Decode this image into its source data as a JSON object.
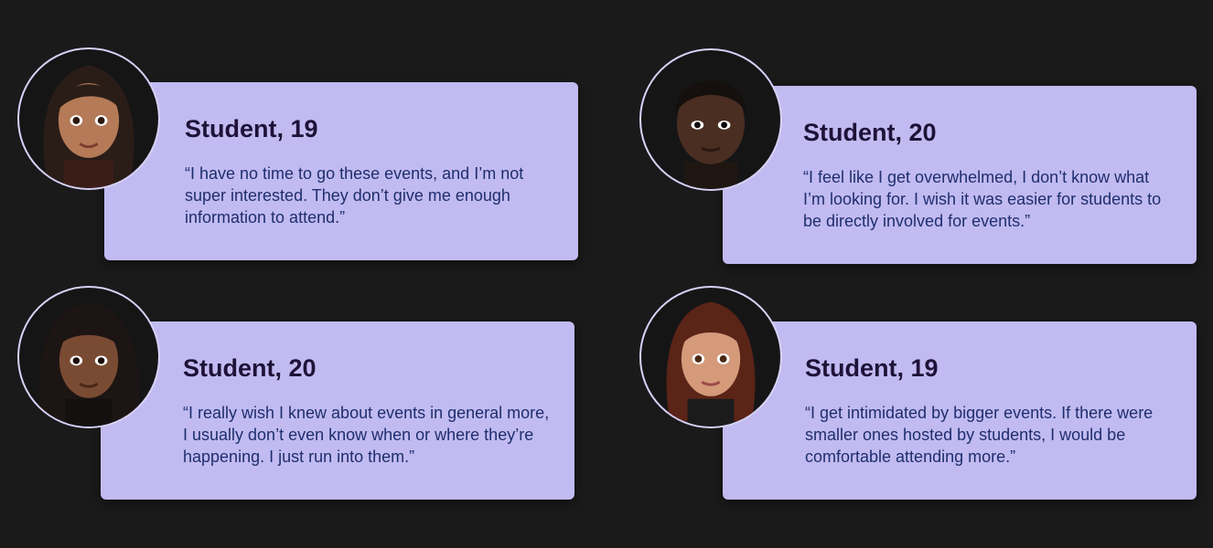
{
  "colors": {
    "background": "#1a1a1b",
    "card": "#c1bbf1",
    "title": "#1e1238",
    "quote": "#1f2e6e",
    "avatar_ring": "#d7d2f7"
  },
  "testimonials": [
    {
      "title": "Student, 19",
      "quote": "“I have no time to go these events, and I’m not super interested. They don’t give me enough information to attend.”",
      "avatar_icon": "memoji-avatar-icon"
    },
    {
      "title": "Student, 20",
      "quote": "“I feel like I get overwhelmed, I don’t know what I’m looking for. I wish it was easier for students to be directly involved for events.”",
      "avatar_icon": "memoji-avatar-icon"
    },
    {
      "title": "Student, 20",
      "quote": "“I really wish I knew about events in general more, I usually don’t even know when or where they’re happening. I just run into them.”",
      "avatar_icon": "memoji-avatar-icon"
    },
    {
      "title": "Student, 19",
      "quote": "“I get intimidated by bigger events. If there were smaller ones hosted by students, I would be comfortable attending more.”",
      "avatar_icon": "memoji-avatar-icon"
    }
  ]
}
